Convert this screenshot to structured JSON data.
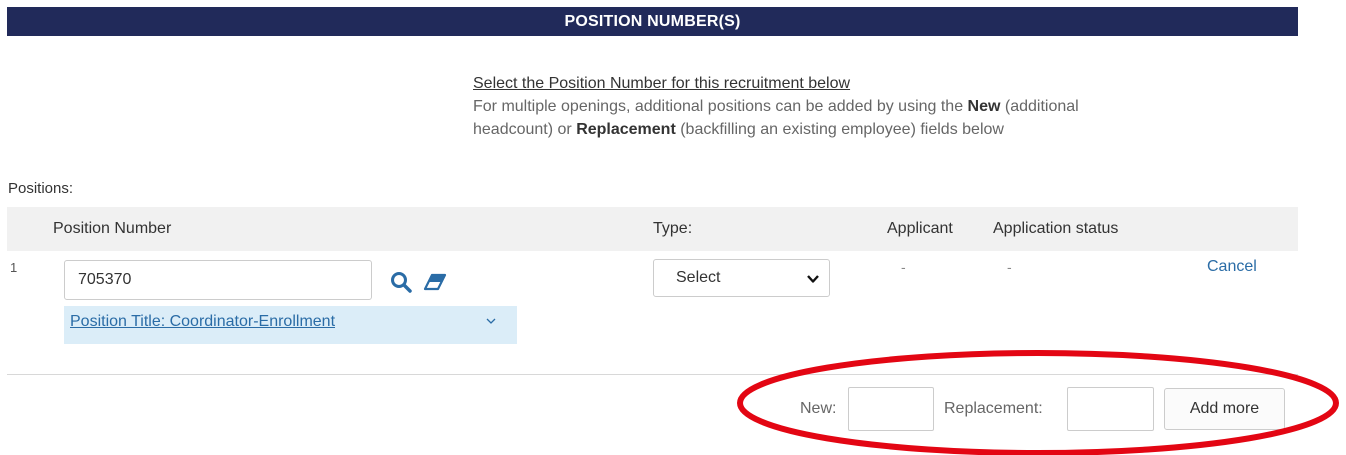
{
  "header": {
    "title": "POSITION NUMBER(S)"
  },
  "instructions": {
    "title": "Select the Position Number for this recruitment below",
    "line1_prefix": "For multiple openings, additional positions can be added by using the ",
    "new_word": "New",
    "line1_suffix": " (additional",
    "line2_prefix": "headcount) or ",
    "replacement_word": "Replacement",
    "line2_suffix": " (backfilling an existing employee) fields below"
  },
  "positions": {
    "label": "Positions:",
    "columns": {
      "position_number": "Position Number",
      "type": "Type:",
      "applicant": "Applicant",
      "application_status": "Application status"
    },
    "rows": [
      {
        "index": "1",
        "position_number": "705370",
        "position_title": "Position Title: Coordinator-Enrollment",
        "type_selected": "Select",
        "applicant": "-",
        "application_status": "-",
        "cancel_label": "Cancel"
      }
    ]
  },
  "footer": {
    "new_label": "New:",
    "new_value": "",
    "replacement_label": "Replacement:",
    "replacement_value": "",
    "add_more_label": "Add more"
  },
  "colors": {
    "header_bg": "#212a5a",
    "link": "#2a6ca6",
    "title_bar_bg": "#dbedf8",
    "annotation": "#e30613"
  },
  "icons": {
    "search": "search-icon",
    "eraser": "eraser-icon",
    "dropdown": "chevron-down-icon"
  }
}
